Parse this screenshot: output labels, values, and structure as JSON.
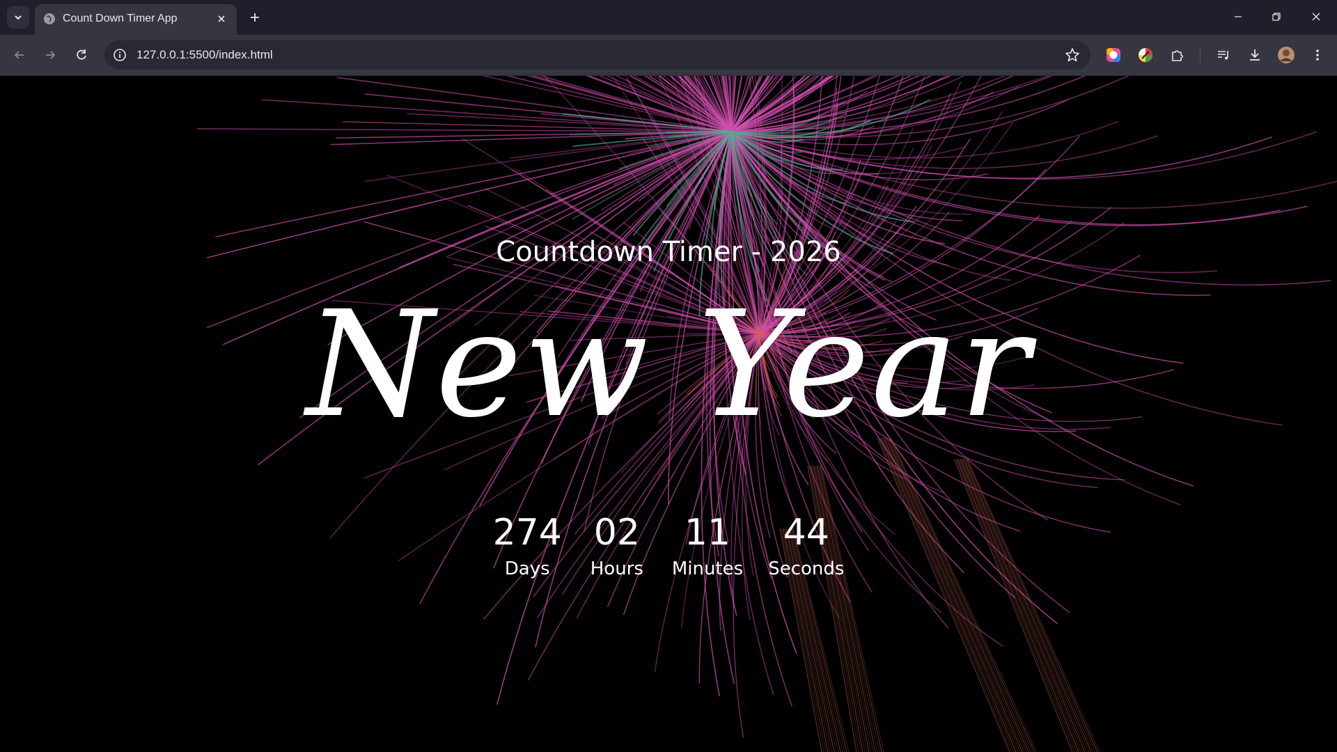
{
  "browser": {
    "tab_title": "Count Down Timer App",
    "url": "127.0.0.1:5500/index.html"
  },
  "page": {
    "subtitle": "Countdown Timer - 2026",
    "headline": "New Year",
    "countdown": [
      {
        "value": "274",
        "label": "Days"
      },
      {
        "value": "02",
        "label": "Hours"
      },
      {
        "value": "11",
        "label": "Minutes"
      },
      {
        "value": "44",
        "label": "Seconds"
      }
    ]
  },
  "colors": {
    "firework_pink": "#d04fae",
    "firework_green": "#4fae8f",
    "firework_orange": "#e0603a"
  }
}
